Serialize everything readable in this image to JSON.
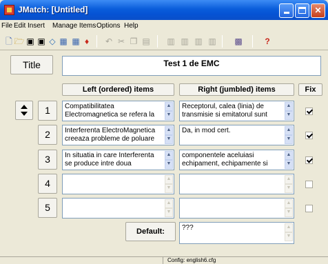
{
  "window": {
    "title": "JMatch: [Untitled]"
  },
  "menu": [
    "File",
    "Edit",
    "Insert",
    "Manage Items",
    "Options",
    "Help"
  ],
  "toolbar": {
    "icons": [
      "new-file-icon",
      "open-folder-icon",
      "save-icon",
      "save-as-icon",
      "tag-icon",
      "compile-html-icon",
      "compile-html2-icon",
      "marker-icon",
      "undo-icon",
      "cut-icon",
      "copy-icon",
      "paste-icon",
      "tool1-icon",
      "tool2-icon",
      "tool3-icon",
      "tool4-icon",
      "screen-icon",
      "help-icon"
    ]
  },
  "header": {
    "title_button": "Title",
    "title_value": "Test 1 de EMC"
  },
  "columns": {
    "left": "Left (ordered) items",
    "right": "Right (jumbled) items",
    "fix": "Fix"
  },
  "rows": [
    {
      "num": "1",
      "left": "Compatibilitatea Electromagnetica se refera la",
      "right": " Receptorul, calea (linia) de transmisie si emitatorul sunt",
      "fixed": true
    },
    {
      "num": "2",
      "left": "Interferenta ElectroMagnetica creeaza probleme de poluare",
      "right": "Da, in mod cert.",
      "fixed": true
    },
    {
      "num": "3",
      "left": "In situatia in care Interferenta se produce intre doua",
      "right": "componentele aceluiasi echipament, echipamente si",
      "fixed": true
    },
    {
      "num": "4",
      "left": "",
      "right": "",
      "fixed": false
    },
    {
      "num": "5",
      "left": "",
      "right": "",
      "fixed": false
    }
  ],
  "default": {
    "label": "Default:",
    "value": "???"
  },
  "status": {
    "text": "Config: english6.cfg"
  }
}
